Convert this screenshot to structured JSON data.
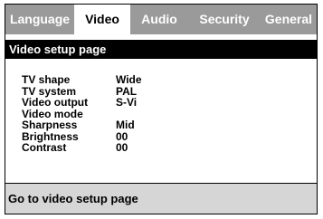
{
  "tabs": [
    {
      "label": "Language",
      "active": false
    },
    {
      "label": "Video",
      "active": true
    },
    {
      "label": "Audio",
      "active": false
    },
    {
      "label": "Security",
      "active": false
    },
    {
      "label": "General",
      "active": false
    }
  ],
  "page_title": "Video setup page",
  "settings": [
    {
      "label": "TV shape",
      "value": "Wide"
    },
    {
      "label": "TV system",
      "value": "PAL"
    },
    {
      "label": "Video output",
      "value": "S-Vi"
    },
    {
      "label": "Video mode",
      "value": ""
    },
    {
      "label": "Sharpness",
      "value": "Mid"
    },
    {
      "label": "Brightness",
      "value": "00"
    },
    {
      "label": "Contrast",
      "value": "00"
    }
  ],
  "status": "Go to video setup page",
  "colors": {
    "tab_bar": "#9a9a9a",
    "title_bar": "#000000",
    "status_bar": "#d6d6d6"
  }
}
